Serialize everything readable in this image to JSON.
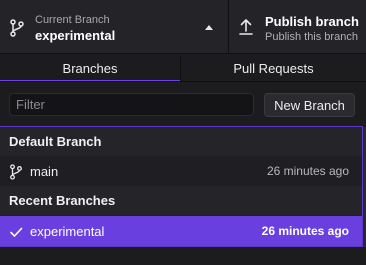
{
  "toolbar": {
    "branch": {
      "caption": "Current Branch",
      "name": "experimental",
      "icon": "git-branch-icon"
    },
    "publish": {
      "title": "Publish branch",
      "subtitle": "Publish this branch",
      "icon": "upload-arrow-icon"
    }
  },
  "tabs": [
    {
      "label": "Branches",
      "active": true
    },
    {
      "label": "Pull Requests",
      "active": false
    }
  ],
  "filter": {
    "placeholder": "Filter",
    "value": ""
  },
  "new_branch_label": "New Branch",
  "groups": [
    {
      "header": "Default Branch",
      "items": [
        {
          "name": "main",
          "time": "26 minutes ago",
          "icon": "git-branch-icon",
          "selected": false
        }
      ]
    },
    {
      "header": "Recent Branches",
      "items": [
        {
          "name": "experimental",
          "time": "26 minutes ago",
          "icon": "checkmark-icon",
          "selected": true
        }
      ]
    }
  ],
  "colors": {
    "accent": "#6a3fe0",
    "background": "#1c1c1f"
  }
}
